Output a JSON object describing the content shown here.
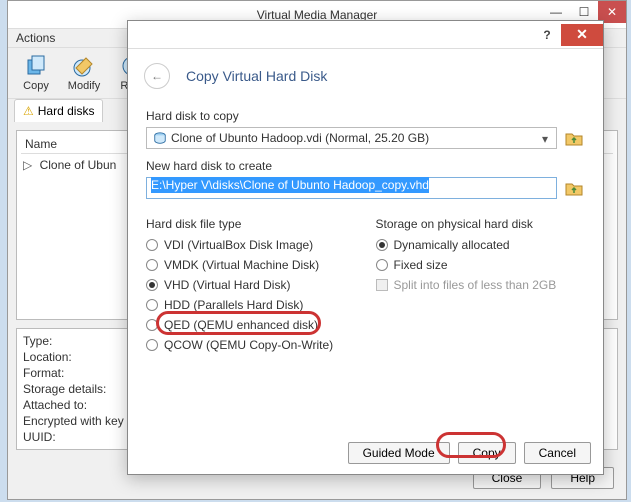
{
  "parent": {
    "title": "Virtual Media Manager",
    "menu_actions": "Actions",
    "toolbar": {
      "copy": "Copy",
      "modify": "Modify",
      "remove": "Rem"
    },
    "tab": "Hard disks",
    "name_header": "Name",
    "tree_item": "Clone of Ubun",
    "info": {
      "type": "Type:",
      "location": "Location:",
      "format": "Format:",
      "storage": "Storage details:",
      "attached": "Attached to:",
      "encrypted": "Encrypted with key",
      "uuid": "UUID:"
    },
    "buttons": {
      "close": "Close",
      "help": "Help"
    }
  },
  "wizard": {
    "heading": "Copy Virtual Hard Disk",
    "section_copy": "Hard disk to copy",
    "dropdown_value": "Clone of Ubunto Hadoop.vdi (Normal, 25.20 GB)",
    "section_new": "New hard disk to create",
    "path_value": "E:\\Hyper V\\disks\\Clone of Ubunto Hadoop_copy.vhd",
    "section_type": "Hard disk file type",
    "types": {
      "vdi": "VDI (VirtualBox Disk Image)",
      "vmdk": "VMDK (Virtual Machine Disk)",
      "vhd": "VHD (Virtual Hard Disk)",
      "hdd": "HDD (Parallels Hard Disk)",
      "qed": "QED (QEMU enhanced disk)",
      "qcow": "QCOW (QEMU Copy-On-Write)"
    },
    "section_storage": "Storage on physical hard disk",
    "storage": {
      "dynamic": "Dynamically allocated",
      "fixed": "Fixed size",
      "split": "Split into files of less than 2GB"
    },
    "buttons": {
      "guided": "Guided Mode",
      "copy": "Copy",
      "cancel": "Cancel"
    }
  }
}
